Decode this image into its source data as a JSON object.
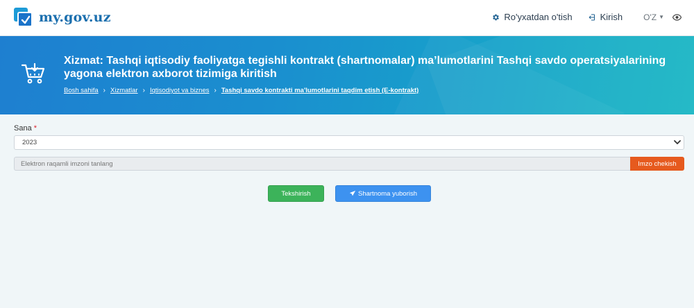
{
  "header": {
    "logo_text": "my.gov.uz",
    "nav": {
      "register_label": "Ro'yxatdan o'tish",
      "login_label": "Kirish",
      "language": "O'Z"
    }
  },
  "banner": {
    "title": "Xizmat: Tashqi iqtisodiy faoliyatga tegishli kontrakt (shartnomalar) ma’lumotlarini Tashqi savdo operatsiyalarining yagona elektron axborot tizimiga kiritish",
    "breadcrumb": [
      "Bosh sahifa",
      "Xizmatlar",
      "Iqtisodiyot va biznes",
      "Tashqi savdo kontrakti ma'lumotlarini taqdim etish (E-kontrakt)"
    ]
  },
  "form": {
    "date_label": "Sana",
    "required_mark": "*",
    "date_value": "2023",
    "signature_placeholder": "Elektron raqamli imzoni tanlang",
    "sign_button": "Imzo chekish",
    "check_button": "Tekshirish",
    "send_button": "Shartnoma yuborish"
  },
  "colors": {
    "banner_start": "#1e7fd0",
    "banner_end": "#1ab7c4",
    "sign_button": "#e65a1e",
    "check_button": "#3cb35a",
    "send_button": "#3d92f0",
    "logo_text": "#1b6fae"
  },
  "icons": {
    "logo": "checkbox-logo-icon",
    "register": "gear-icon",
    "login": "sign-in-icon",
    "language_caret": "caret-down-icon",
    "accessibility": "eye-icon",
    "service": "shopping-cart-icon",
    "breadcrumb_separator": "chevron-right-icon",
    "select": "chevron-down-icon",
    "send": "paper-plane-icon"
  }
}
